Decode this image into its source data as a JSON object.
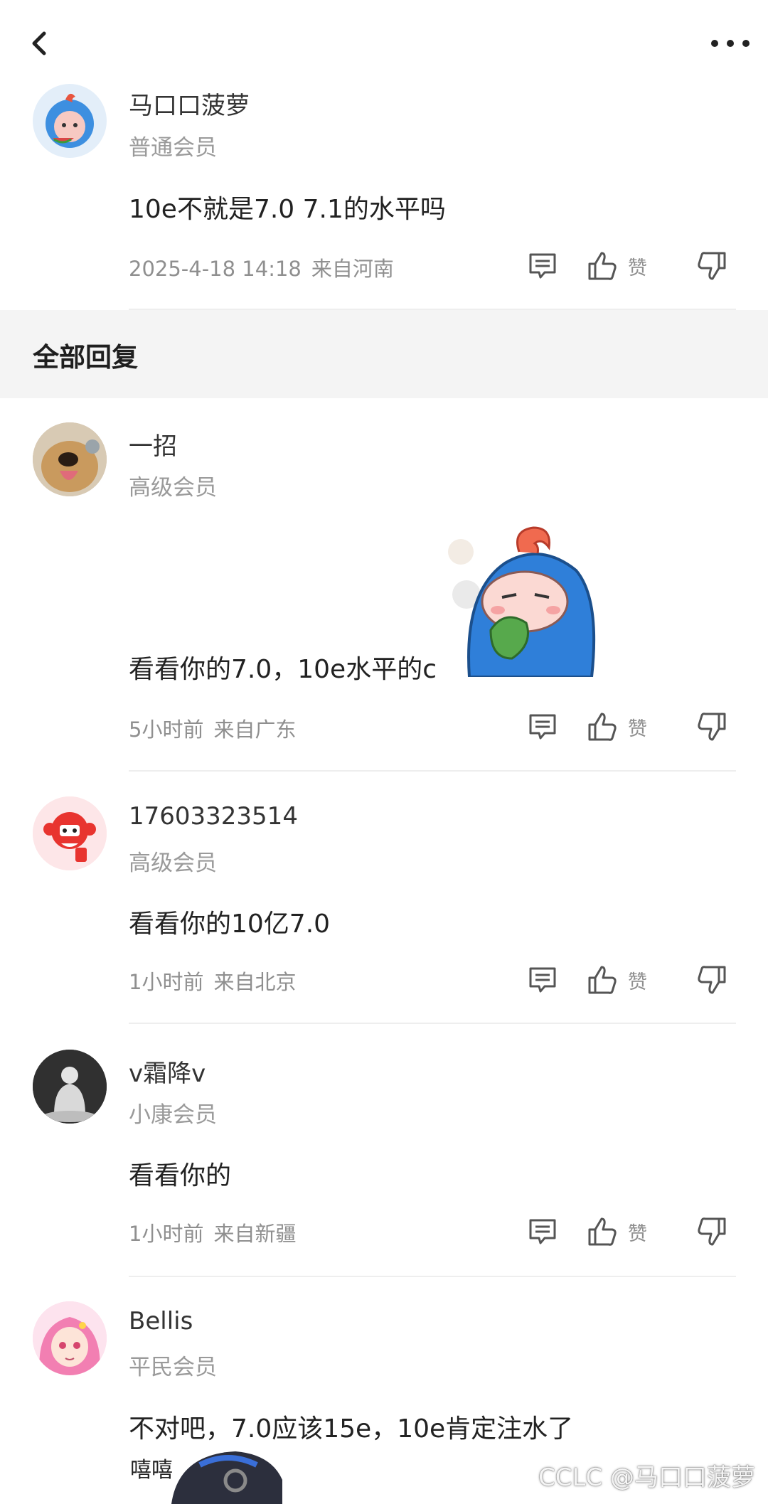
{
  "header": {
    "back_icon": "chevron-left-icon",
    "more_icon": "more-horizontal-icon"
  },
  "main_comment": {
    "username": "马口口菠萝",
    "level": "普通会员",
    "text": "10e不就是7.0 7.1的水平吗",
    "time": "2025-4-18 14:18",
    "location": "来自河南",
    "like_label": "赞"
  },
  "section": {
    "title": "全部回复"
  },
  "replies": [
    {
      "username": "一招",
      "level": "高级会员",
      "text": "看看你的7.0，10e水平的c",
      "time": "5小时前",
      "location": "来自广东",
      "like_label": "赞"
    },
    {
      "username": "17603323514",
      "level": "高级会员",
      "text": "看看你的10亿7.0",
      "time": "1小时前",
      "location": "来自北京",
      "like_label": "赞"
    },
    {
      "username": "v霜降v",
      "level": "小康会员",
      "text": "看看你的",
      "time": "1小时前",
      "location": "来自新疆",
      "like_label": "赞"
    },
    {
      "username": "Bellis",
      "level": "平民会员",
      "text": "不对吧，7.0应该15e，10e肯定注水了",
      "sticker_text": "嘻嘻"
    }
  ],
  "watermark": "CCLC @马口口菠萝"
}
